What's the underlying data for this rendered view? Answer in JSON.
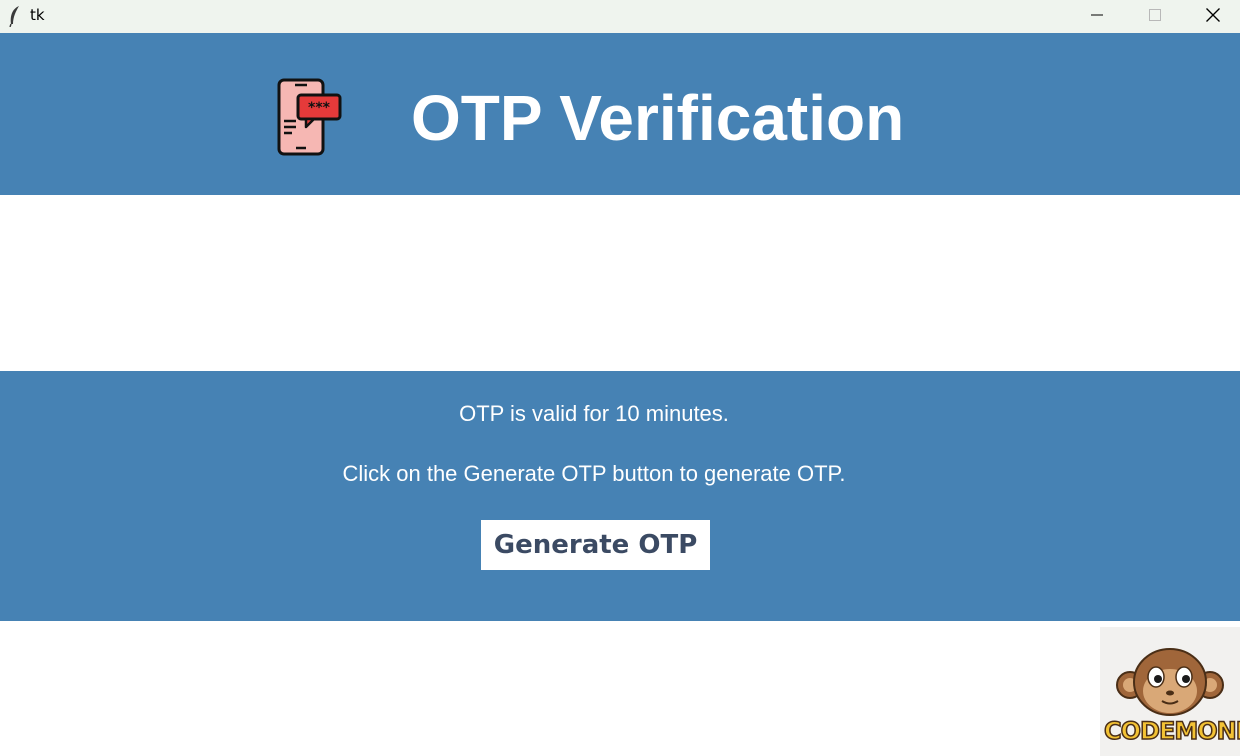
{
  "window": {
    "title": "tk",
    "controls": {
      "minimize_icon": "minimize-icon",
      "maximize_icon": "maximize-icon",
      "close_icon": "close-icon"
    }
  },
  "header": {
    "icon": "phone-otp-icon",
    "title": "OTP Verification",
    "background": "#4682b4"
  },
  "info": {
    "line1": "OTP is valid for 10 minutes.",
    "line2": "Click on the Generate OTP button to generate OTP.",
    "button_label": "Generate OTP"
  },
  "logo": {
    "text": "CODEMONKEY",
    "icon": "monkey-logo-icon"
  },
  "colors": {
    "primary": "#4682b4",
    "button_text": "#3b4a63",
    "background": "#ffffff"
  }
}
